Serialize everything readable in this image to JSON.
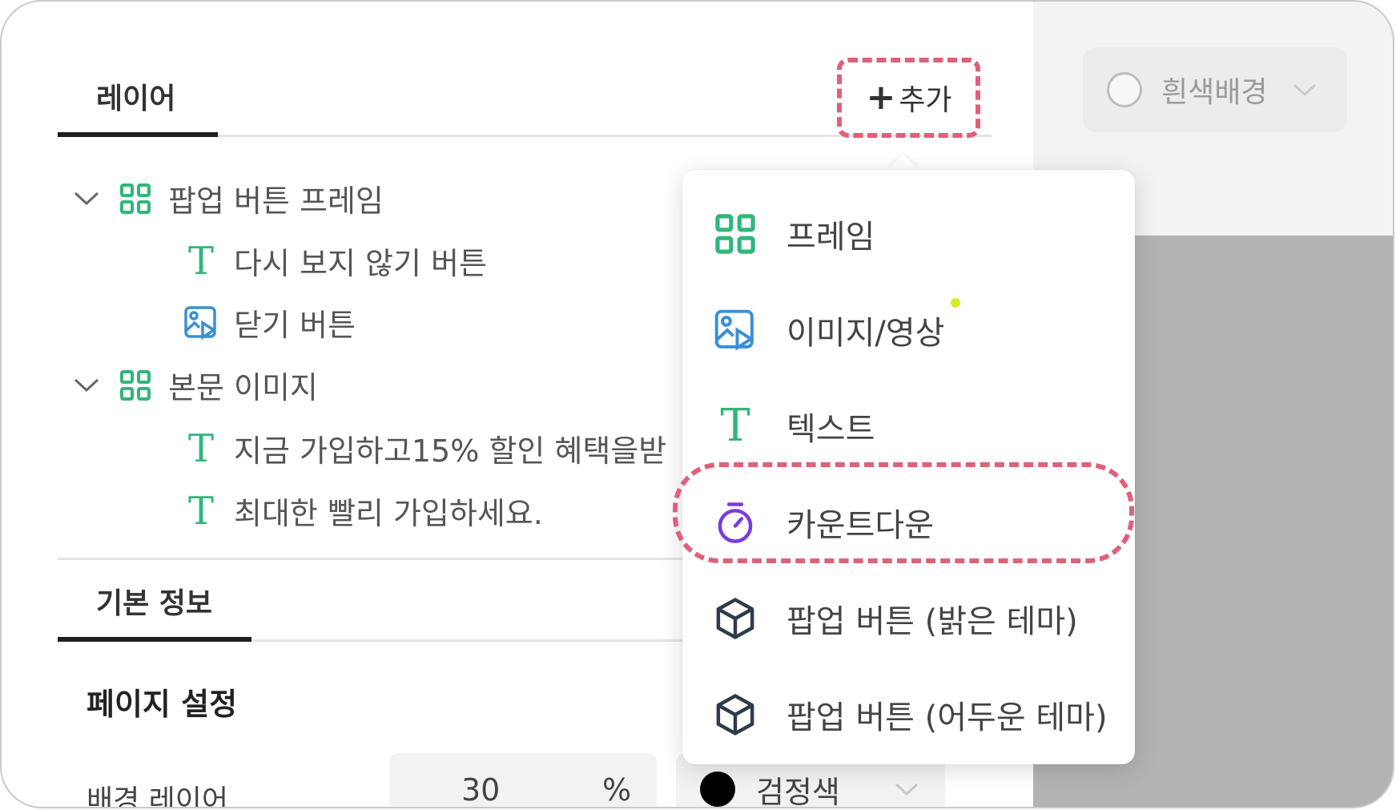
{
  "layers_panel": {
    "tab_label": "레이어",
    "add_button_label": "추가",
    "add_button_plus": "+"
  },
  "layer_tree": [
    {
      "type": "frame",
      "label": "팝업 버튼 프레임",
      "expanded": true
    },
    {
      "type": "text",
      "label": "다시 보지 않기 버튼"
    },
    {
      "type": "media",
      "label": "닫기 버튼"
    },
    {
      "type": "frame",
      "label": "본문 이미지",
      "expanded": true
    },
    {
      "type": "text",
      "label": "지금 가입하고15% 할인 혜택을받"
    },
    {
      "type": "text",
      "label": "최대한 빨리 가입하세요."
    }
  ],
  "info_panel": {
    "tab_label": "기본 정보",
    "section_title": "페이지 설정",
    "background_layer_label": "배경 레이어",
    "opacity_value": "30",
    "opacity_unit": "%",
    "color_value": "검정색"
  },
  "preview": {
    "background_select_label": "흰색배경"
  },
  "add_menu": {
    "items": [
      {
        "label": "프레임",
        "icon": "frame-icon"
      },
      {
        "label": "이미지/영상",
        "icon": "image-video-icon"
      },
      {
        "label": "텍스트",
        "icon": "text-icon"
      },
      {
        "label": "카운트다운",
        "icon": "timer-icon",
        "highlighted": true
      },
      {
        "label": "팝업 버튼 (밝은 테마)",
        "icon": "cube-icon"
      },
      {
        "label": "팝업 버튼 (어두운 테마)",
        "icon": "cube-icon"
      }
    ]
  },
  "colors": {
    "accent_green": "#2fb77a",
    "media_blue": "#3a8fd6",
    "timer_purple": "#7a3be0",
    "highlight_pink": "#e0607a",
    "cube_dark": "#2f3b4a"
  }
}
